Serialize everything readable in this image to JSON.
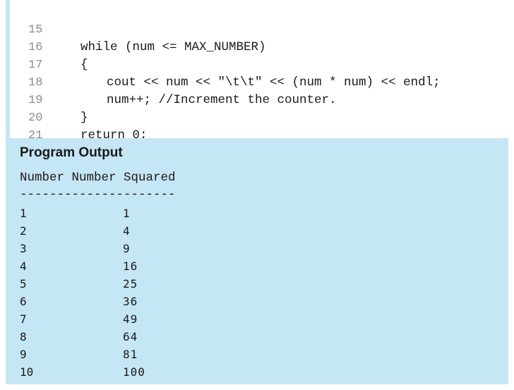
{
  "code": {
    "lines": [
      {
        "num": "15",
        "text": "while (num <= MAX_NUMBER)"
      },
      {
        "num": "16",
        "text": "{"
      },
      {
        "num": "17",
        "text": "cout << num << \"\\t\\t\" << (num * num) << endl;"
      },
      {
        "num": "18",
        "text": "num++; //Increment the counter."
      },
      {
        "num": "19",
        "text": "}"
      },
      {
        "num": "20",
        "text": "return 0;"
      },
      {
        "num": "21",
        "text": "}"
      }
    ]
  },
  "output": {
    "heading": "Program Output",
    "header_line": "Number Number Squared",
    "separator": "---------------------",
    "rows": [
      {
        "number": "1",
        "squared": "1"
      },
      {
        "number": "2",
        "squared": "4"
      },
      {
        "number": "3",
        "squared": "9"
      },
      {
        "number": "4",
        "squared": "16"
      },
      {
        "number": "5",
        "squared": "25"
      },
      {
        "number": "6",
        "squared": "36"
      },
      {
        "number": "7",
        "squared": "49"
      },
      {
        "number": "8",
        "squared": "64"
      },
      {
        "number": "9",
        "squared": "81"
      },
      {
        "number": "10",
        "squared": "100"
      }
    ]
  }
}
